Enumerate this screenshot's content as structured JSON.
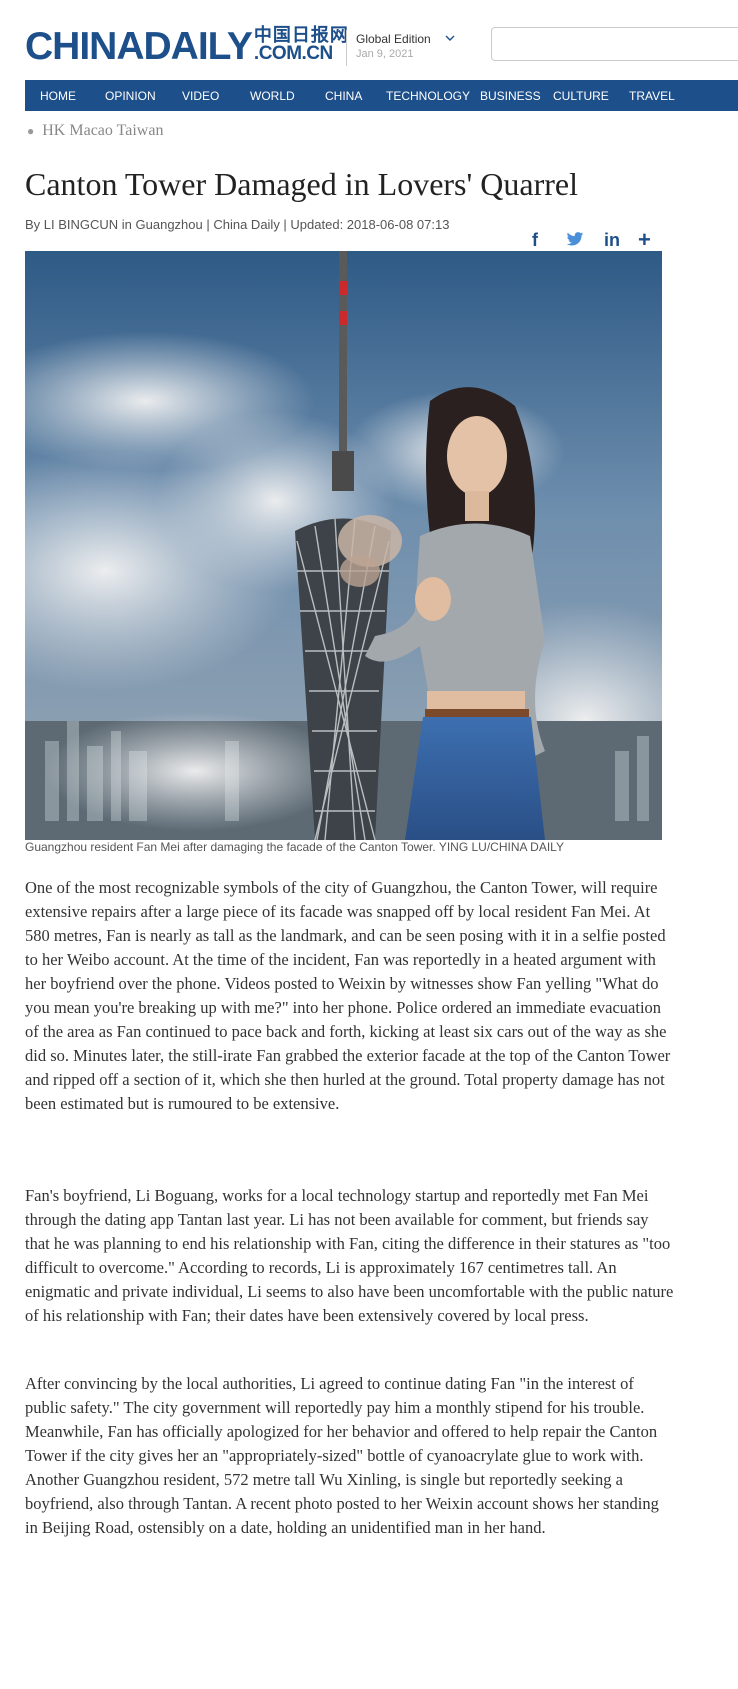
{
  "header": {
    "logo_main": "CHINADAILY",
    "logo_cn": "中国日报网",
    "logo_com": ".COM.CN",
    "edition": "Global Edition",
    "date": "Jan 9, 2021"
  },
  "nav": {
    "items": [
      "HOME",
      "OPINION",
      "VIDEO",
      "WORLD",
      "CHINA",
      "TECHNOLOGY",
      "BUSINESS",
      "CULTURE",
      "TRAVEL"
    ]
  },
  "subnav": {
    "label": "HK Macao Taiwan"
  },
  "article": {
    "title": "Canton Tower Damaged in Lovers' Quarrel",
    "byline": "By LI BINGCUN in Guangzhou | China Daily | Updated: 2018-06-08 07:13",
    "caption": "Guangzhou resident Fan Mei after damaging the facade of the Canton Tower. YING LU/CHINA DAILY",
    "paragraphs": [
      "One of the most recognizable symbols of the city of Guangzhou, the Canton Tower, will require extensive repairs after a large piece of its facade was snapped off by local resident Fan Mei. At 580 metres, Fan is nearly as tall as the landmark, and can be seen posing with it in a selfie posted to her Weibo account. At the time of the incident, Fan was reportedly in a heated argument with her boyfriend over the phone. Videos posted to Weixin by witnesses show Fan yelling \"What do you mean you're breaking up with me?\" into her phone. Police ordered an immediate evacuation of the area as Fan continued to pace back and forth, kicking at least six cars out of the way as she did so. Minutes later, the still-irate Fan grabbed the exterior facade at the top of the Canton Tower and ripped off a section of it, which she then hurled at the ground. Total property damage has not been estimated but is rumoured to be extensive.",
      "Fan's boyfriend, Li Boguang, works for a local technology startup and reportedly met Fan Mei through the dating app Tantan last year. Li has not been available for comment, but friends say that he was planning to end his relationship with Fan, citing the difference in their statures as \"too difficult to overcome.\" According to records, Li is approximately 167 centimetres tall. An enigmatic and private individual, Li seems to also have been uncomfortable with the public nature of his relationship with Fan; their dates have been extensively covered by local press.",
      "After convincing by the local authorities, Li agreed to continue dating Fan \"in the interest of public safety.\" The city government will reportedly pay him a monthly stipend for his trouble. Meanwhile, Fan has officially apologized for her behavior and offered to help repair the Canton Tower if the city gives her an \"appropriately-sized\" bottle of cyanoacrylate glue to work with. Another Guangzhou resident, 572 metre tall Wu Xinling, is single but reportedly seeking a boyfriend, also through Tantan. A recent photo posted to her Weixin account shows her standing in Beijing Road, ostensibly on a date, holding an unidentified man in her hand."
    ]
  },
  "share": {
    "facebook": "f",
    "linkedin": "in",
    "more": "+"
  },
  "colors": {
    "brand_blue": "#1d4f8a",
    "nav_text": "#ffffff"
  }
}
